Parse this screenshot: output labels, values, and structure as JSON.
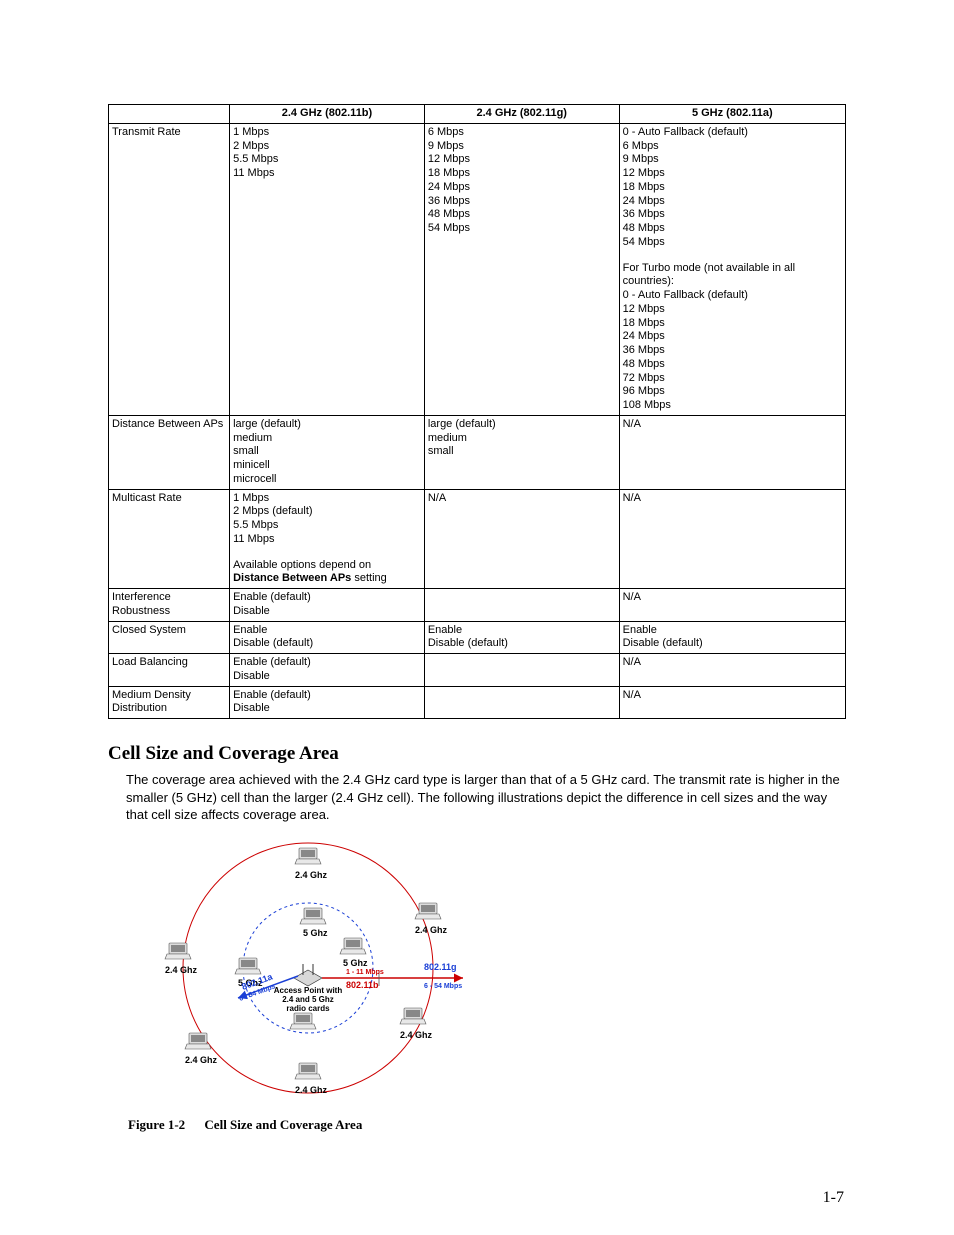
{
  "table": {
    "headers": [
      "",
      "2.4 GHz (802.11b)",
      "2.4 GHz (802.11g)",
      "5 GHz (802.11a)"
    ],
    "rows": [
      {
        "label": "Transmit Rate",
        "b": [
          "1 Mbps",
          "2 Mbps",
          "5.5 Mbps",
          "11 Mbps"
        ],
        "g": [
          "6 Mbps",
          "9 Mbps",
          "12 Mbps",
          "18 Mbps",
          "24 Mbps",
          "36 Mbps",
          "48 Mbps",
          "54 Mbps"
        ],
        "a_main": [
          "0 - Auto Fallback (default)",
          "6 Mbps",
          "9 Mbps",
          "12 Mbps",
          "18 Mbps",
          "24 Mbps",
          "36 Mbps",
          "48 Mbps",
          "54 Mbps"
        ],
        "a_turbo_intro": "For Turbo mode (not available in all countries):",
        "a_turbo": [
          "0 - Auto Fallback (default)",
          "12 Mbps",
          "18 Mbps",
          "24 Mbps",
          "36 Mbps",
          "48 Mbps",
          "72 Mbps",
          "96 Mbps",
          "108 Mbps"
        ]
      },
      {
        "label": "Distance Between APs",
        "b": [
          "large (default)",
          "medium",
          "small",
          "minicell",
          "microcell"
        ],
        "g": [
          "large (default)",
          "medium",
          "small"
        ],
        "a": "N/A"
      },
      {
        "label": "Multicast Rate",
        "b_lines": [
          "1 Mbps",
          "2 Mbps (default)",
          "5.5 Mbps",
          "11 Mbps"
        ],
        "b_note_plain": "Available options depend on ",
        "b_note_bold": "Distance Between APs",
        "b_note_tail": " setting",
        "g": "N/A",
        "a": "N/A"
      },
      {
        "label": "Interference Robustness",
        "b": [
          "Enable (default)",
          "Disable"
        ],
        "g": "",
        "a": "N/A"
      },
      {
        "label": "Closed System",
        "b": [
          "Enable",
          "Disable (default)"
        ],
        "g": [
          "Enable",
          "Disable (default)"
        ],
        "a": [
          "Enable",
          "Disable (default)"
        ]
      },
      {
        "label": "Load Balancing",
        "b": [
          "Enable (default)",
          "Disable"
        ],
        "g": "",
        "a": "N/A"
      },
      {
        "label": "Medium Density Distribution",
        "b": [
          "Enable (default)",
          "Disable"
        ],
        "g": "",
        "a": "N/A"
      }
    ]
  },
  "section_heading": "Cell Size and Coverage Area",
  "body_text": "The coverage area achieved with the 2.4 GHz card type is larger than that of a 5 GHz card. The transmit rate is higher in the smaller (5 GHz) cell than the larger (2.4 GHz cell). The following illustrations depict the difference in cell sizes and the way that cell size affects coverage area.",
  "figure": {
    "labels": {
      "ghz24": "2.4 Ghz",
      "ghz5": "5 Ghz",
      "ap_line1": "Access Point with",
      "ap_line2": "2.4 and 5 Ghz",
      "ap_line3": "radio cards",
      "std_a": "802.11a",
      "std_a_rate": "6 - 54 Mbps",
      "std_g": "802.11g",
      "std_g_rate": "6 - 54 Mbps",
      "std_b_rate": "1 - 11 Mbps",
      "std_b": "802.11b"
    },
    "caption_num": "Figure 1-2",
    "caption_title": "Cell Size and Coverage Area"
  },
  "page_number": "1-7"
}
